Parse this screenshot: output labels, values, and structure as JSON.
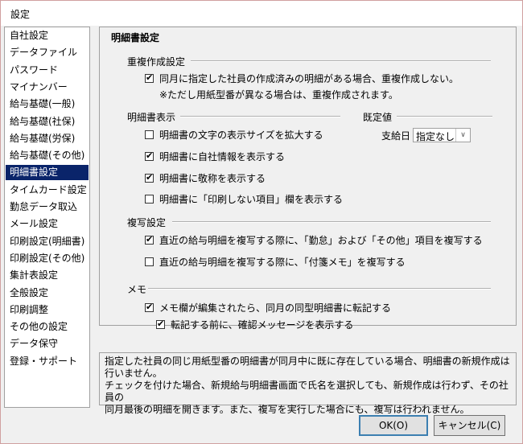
{
  "window": {
    "title": "設定"
  },
  "sidebar": {
    "items": [
      {
        "label": "自社設定"
      },
      {
        "label": "データファイル"
      },
      {
        "label": "パスワード"
      },
      {
        "label": "マイナンバー"
      },
      {
        "label": "給与基礎(一般)"
      },
      {
        "label": "給与基礎(社保)"
      },
      {
        "label": "給与基礎(労保)"
      },
      {
        "label": "給与基礎(その他)"
      },
      {
        "label": "明細書設定",
        "selected": true
      },
      {
        "label": "タイムカード設定"
      },
      {
        "label": "勤怠データ取込"
      },
      {
        "label": "メール設定"
      },
      {
        "label": "印刷設定(明細書)"
      },
      {
        "label": "印刷設定(その他)"
      },
      {
        "label": "集計表設定"
      },
      {
        "label": "全般設定"
      },
      {
        "label": "印刷調整"
      },
      {
        "label": "その他の設定"
      },
      {
        "label": "データ保守"
      },
      {
        "label": "登録・サポート"
      }
    ]
  },
  "main": {
    "title": "明細書設定",
    "duplicate": {
      "heading": "重複作成設定",
      "check_label": "同月に指定した社員の作成済みの明細がある場合、重複作成しない。",
      "checked": true,
      "note": "※ただし用紙型番が異なる場合は、重複作成されます。"
    },
    "display": {
      "heading": "明細書表示",
      "options": [
        {
          "label": "明細書の文字の表示サイズを拡大する",
          "checked": false
        },
        {
          "label": "明細書に自社情報を表示する",
          "checked": true
        },
        {
          "label": "明細書に敬称を表示する",
          "checked": true
        },
        {
          "label": "明細書に「印刷しない項目」欄を表示する",
          "checked": false
        }
      ]
    },
    "defaults": {
      "heading": "既定値",
      "payday_label": "支給日",
      "payday_value": "指定なし"
    },
    "copy": {
      "heading": "複写設定",
      "options": [
        {
          "label": "直近の給与明細を複写する際に、「勤怠」および「その他」項目を複写する",
          "checked": true
        },
        {
          "label": "直近の給与明細を複写する際に、「付箋メモ」を複写する",
          "checked": false
        }
      ]
    },
    "memo": {
      "heading": "メモ",
      "option1": {
        "label": "メモ欄が編集されたら、同月の同型明細書に転記する",
        "checked": true
      },
      "option2": {
        "label": "転記する前に、確認メッセージを表示する",
        "checked": true
      }
    }
  },
  "description": {
    "line1": "指定した社員の同じ用紙型番の明細書が同月中に既に存在している場合、明細書の新規作成は",
    "line2": "行いません。",
    "line3": "チェックを付けた場合、新規給与明細書画面で氏名を選択しても、新規作成は行わず、その社員の",
    "line4": "同月最後の明細を開きます。また、複写を実行した場合にも、複写は行われません。"
  },
  "buttons": {
    "ok": "OK(O)",
    "cancel": "キャンセル(C)"
  }
}
